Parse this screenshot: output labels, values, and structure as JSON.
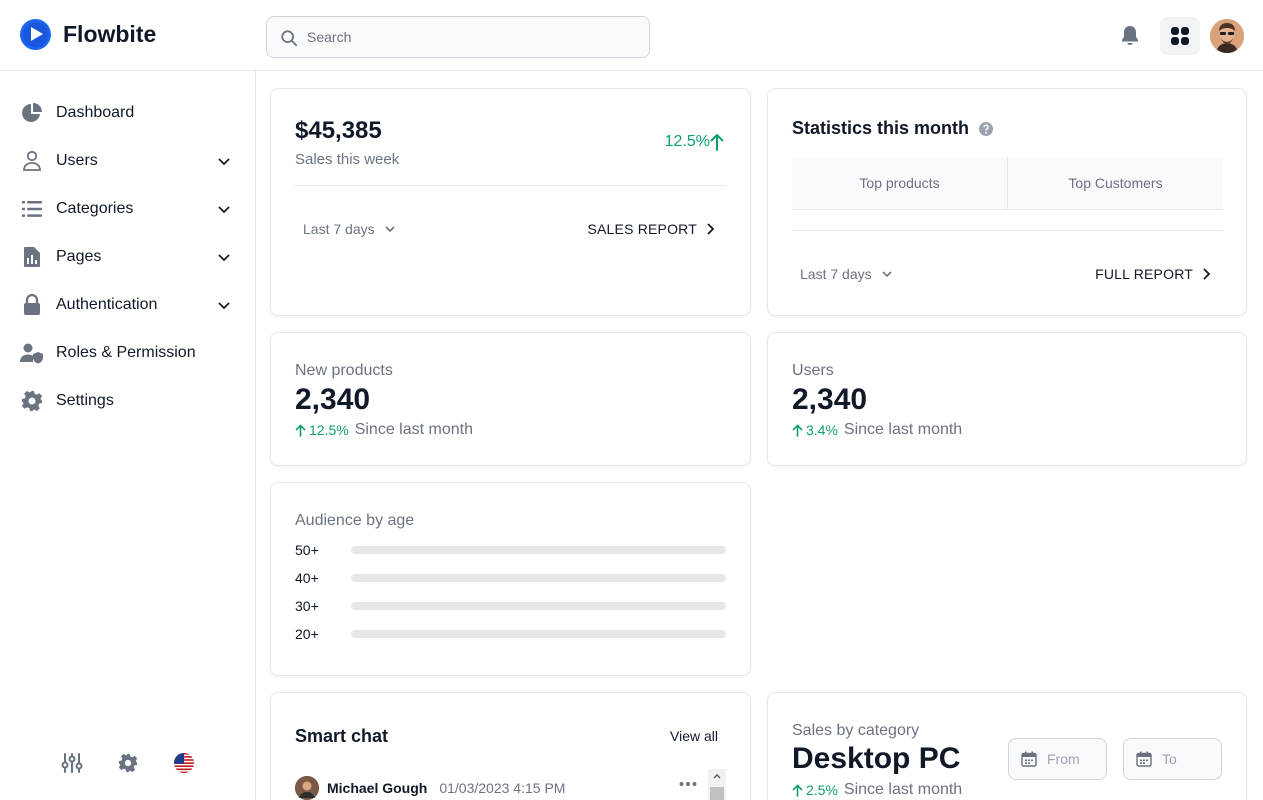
{
  "brand": {
    "name": "Flowbite",
    "accent": "#1c64f2"
  },
  "search": {
    "placeholder": "Search"
  },
  "navbar_icons": [
    "bell-icon",
    "apps-grid-icon",
    "user-avatar"
  ],
  "sidebar": {
    "items": [
      {
        "label": "Dashboard",
        "icon": "chart-pie-icon",
        "expandable": false
      },
      {
        "label": "Users",
        "icon": "user-icon",
        "expandable": true
      },
      {
        "label": "Categories",
        "icon": "list-icon",
        "expandable": true
      },
      {
        "label": "Pages",
        "icon": "document-chart-icon",
        "expandable": true
      },
      {
        "label": "Authentication",
        "icon": "lock-icon",
        "expandable": true
      },
      {
        "label": "Roles & Permission",
        "icon": "users-shield-icon",
        "expandable": false
      },
      {
        "label": "Settings",
        "icon": "cog-icon",
        "expandable": false
      }
    ],
    "bottom_icons": [
      "adjustments-icon",
      "settings-icon",
      "us-flag-icon"
    ]
  },
  "sales_card": {
    "amount": "$45,385",
    "subtitle": "Sales this week",
    "change": "12.5%",
    "range": "Last 7 days",
    "report_link": "SALES REPORT"
  },
  "stats_card": {
    "title": "Statistics this month",
    "tabs": [
      "Top products",
      "Top Customers"
    ],
    "range": "Last 7 days",
    "report_link": "FULL REPORT"
  },
  "new_products": {
    "label": "New products",
    "value": "2,340",
    "change": "12.5%",
    "since": "Since last month"
  },
  "users": {
    "label": "Users",
    "value": "2,340",
    "change": "3.4%",
    "since": "Since last month"
  },
  "audience": {
    "title": "Audience by age",
    "groups": [
      {
        "label": "50+",
        "value": 0
      },
      {
        "label": "40+",
        "value": 0
      },
      {
        "label": "30+",
        "value": 0
      },
      {
        "label": "20+",
        "value": 0
      }
    ]
  },
  "smart_chat": {
    "title": "Smart chat",
    "view_all": "View all",
    "messages": [
      {
        "name": "Michael Gough",
        "time": "01/03/2023 4:15 PM"
      }
    ]
  },
  "sales_by_category": {
    "label": "Sales by category",
    "value": "Desktop PC",
    "change": "2.5%",
    "since": "Since last month",
    "from_placeholder": "From",
    "to_placeholder": "To"
  }
}
